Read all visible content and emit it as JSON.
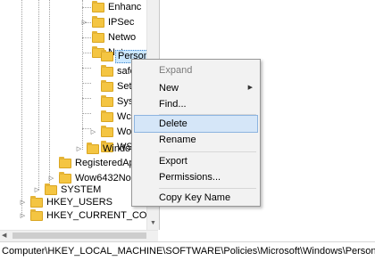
{
  "tree": {
    "items": [
      {
        "label": "Enhanc"
      },
      {
        "label": "IPSec"
      },
      {
        "label": "Netwo"
      },
      {
        "label": "Netwo"
      },
      {
        "label": "Person"
      },
      {
        "label": "safer"
      },
      {
        "label": "Settin"
      },
      {
        "label": "Syste"
      },
      {
        "label": "Wcm"
      },
      {
        "label": "Wor"
      },
      {
        "label": "WSD"
      },
      {
        "label": "Window"
      },
      {
        "label": "RegisteredAppl"
      },
      {
        "label": "Wow6432Node"
      },
      {
        "label": "SYSTEM"
      },
      {
        "label": "HKEY_USERS"
      },
      {
        "label": "HKEY_CURRENT_CONFIG"
      }
    ]
  },
  "context_menu": {
    "items": [
      {
        "label": "Expand",
        "state": "disabled"
      },
      {
        "label": "New"
      },
      {
        "label": "Find..."
      },
      {
        "label": "Delete",
        "state": "hover"
      },
      {
        "label": "Rename"
      },
      {
        "label": "Export"
      },
      {
        "label": "Permissions..."
      },
      {
        "label": "Copy Key Name"
      }
    ]
  },
  "statusbar": {
    "path": "Computer\\HKEY_LOCAL_MACHINE\\SOFTWARE\\Policies\\Microsoft\\Windows\\Personalization"
  },
  "colors": {
    "folder": "#f4c542",
    "selection": "#cce8ff",
    "menu_hover": "#d5e6f8"
  },
  "icons": {
    "folder": "folder-icon",
    "expand": "expand-arrow-icon",
    "submenu": "submenu-arrow-icon"
  }
}
